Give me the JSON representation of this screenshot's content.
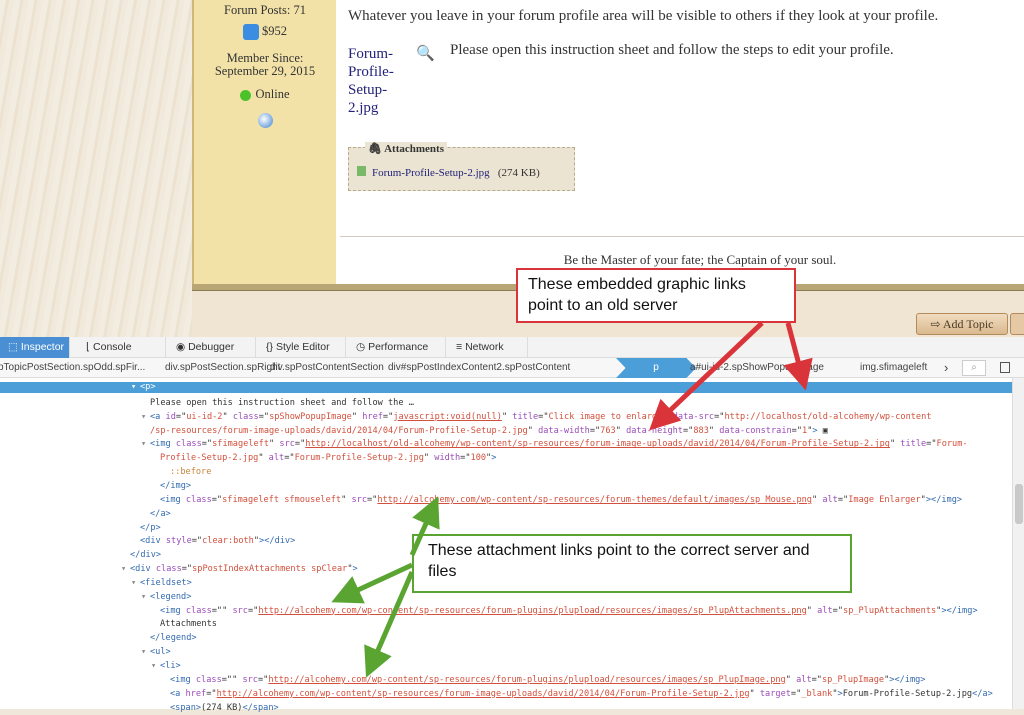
{
  "forum": {
    "profile": {
      "posts": "Forum Posts: 71",
      "money": "$952",
      "member_since_label": "Member Since:",
      "member_since": "September 29, 2015",
      "status": "Online"
    },
    "post": {
      "intro": "Whatever you leave in your forum profile area will be visible to others if they look at your profile.",
      "image_link": "Forum-Profile-Setup-2.jpg",
      "instruction": "Please open this instruction sheet and follow the steps to edit your profile.",
      "attachments_label": "Attachments",
      "attachment_name": "Forum-Profile-Setup-2.jpg",
      "attachment_size": "(274 KB)",
      "signature": "Be the Master of your fate; the Captain of your soul."
    },
    "add_topic": "Add Topic"
  },
  "devtools": {
    "tabs": [
      {
        "label": "Inspector",
        "icon": "inspector-icon"
      },
      {
        "label": "Console",
        "icon": "console-icon"
      },
      {
        "label": "Debugger",
        "icon": "debugger-icon"
      },
      {
        "label": "Style Editor",
        "icon": "style-editor-icon"
      },
      {
        "label": "Performance",
        "icon": "performance-icon"
      },
      {
        "label": "Network",
        "icon": "network-icon"
      }
    ],
    "selected_tab": "Inspector",
    "breadcrumbs": [
      "pTopicPostSection.spOdd.spFir...",
      "div.spPostSection.spRight",
      "div.spPostContentSection",
      "div#spPostIndexContent2.spPostContent",
      "p",
      "a#ui-id-2.spShowPopupImage",
      "img.sfimageleft"
    ],
    "selected_crumb": "p",
    "lines": [
      {
        "depth": 2,
        "twisty": true,
        "sel": true,
        "tokens": [
          [
            "tg",
            "<p>"
          ]
        ]
      },
      {
        "depth": 3,
        "tokens": [
          [
            "tx",
            "Please open this instruction sheet and follow the …"
          ]
        ]
      },
      {
        "depth": 3,
        "twisty": true,
        "tokens": [
          [
            "tg",
            "<a "
          ],
          [
            "at",
            "id"
          ],
          [
            "tx",
            "=\""
          ],
          [
            "va",
            "ui-id-2"
          ],
          [
            "tx",
            "\" "
          ],
          [
            "at",
            "class"
          ],
          [
            "tx",
            "=\""
          ],
          [
            "va",
            "spShowPopupImage"
          ],
          [
            "tx",
            "\" "
          ],
          [
            "at",
            "href"
          ],
          [
            "tx",
            "=\""
          ],
          [
            "lk",
            "javascript:void(null)"
          ],
          [
            "tx",
            "\" "
          ],
          [
            "at",
            "title"
          ],
          [
            "tx",
            "=\""
          ],
          [
            "va",
            "Click image to enlarge"
          ],
          [
            "tx",
            "\" "
          ],
          [
            "at",
            "data-src"
          ],
          [
            "tx",
            "=\""
          ],
          [
            "va",
            "http://localhost/old-alcohemy/wp-content"
          ]
        ]
      },
      {
        "depth": 3,
        "cont": true,
        "tokens": [
          [
            "va",
            "/sp-resources/forum-image-uploads/david/2014/04/Forum-Profile-Setup-2.jpg"
          ],
          [
            "tx",
            "\" "
          ],
          [
            "at",
            "data-width"
          ],
          [
            "tx",
            "=\""
          ],
          [
            "va",
            "763"
          ],
          [
            "tx",
            "\" "
          ],
          [
            "at",
            "data-height"
          ],
          [
            "tx",
            "=\""
          ],
          [
            "va",
            "883"
          ],
          [
            "tx",
            "\" "
          ],
          [
            "at",
            "data-constrain"
          ],
          [
            "tx",
            "=\""
          ],
          [
            "va",
            "1"
          ],
          [
            "tx",
            "\""
          ],
          [
            "tg",
            ">"
          ],
          [
            "tx",
            " ▣"
          ]
        ]
      },
      {
        "depth": 3,
        "twisty": true,
        "tokens": [
          [
            "tg",
            "<img "
          ],
          [
            "at",
            "class"
          ],
          [
            "tx",
            "=\""
          ],
          [
            "va",
            "sfimageleft"
          ],
          [
            "tx",
            "\" "
          ],
          [
            "at",
            "src"
          ],
          [
            "tx",
            "=\""
          ],
          [
            "lk",
            "http://localhost/old-alcohemy/wp-content/sp-resources/forum-image-uploads/david/2014/04/Forum-Profile-Setup-2.jpg"
          ],
          [
            "tx",
            "\" "
          ],
          [
            "at",
            "title"
          ],
          [
            "tx",
            "=\""
          ],
          [
            "va",
            "Forum-"
          ]
        ]
      },
      {
        "depth": 4,
        "cont": true,
        "tokens": [
          [
            "va",
            "Profile-Setup-2.jpg"
          ],
          [
            "tx",
            "\" "
          ],
          [
            "at",
            "alt"
          ],
          [
            "tx",
            "=\""
          ],
          [
            "va",
            "Forum-Profile-Setup-2.jpg"
          ],
          [
            "tx",
            "\" "
          ],
          [
            "at",
            "width"
          ],
          [
            "tx",
            "=\""
          ],
          [
            "va",
            "100"
          ],
          [
            "tx",
            "\""
          ],
          [
            "tg",
            ">"
          ]
        ]
      },
      {
        "depth": 5,
        "tokens": [
          [
            "ps",
            "::before"
          ]
        ]
      },
      {
        "depth": 4,
        "tokens": [
          [
            "tg",
            "</img>"
          ]
        ]
      },
      {
        "depth": 4,
        "tokens": [
          [
            "tg",
            "<img "
          ],
          [
            "at",
            "class"
          ],
          [
            "tx",
            "=\""
          ],
          [
            "va",
            "sfimageleft sfmouseleft"
          ],
          [
            "tx",
            "\" "
          ],
          [
            "at",
            "src"
          ],
          [
            "tx",
            "=\""
          ],
          [
            "lk",
            "http://alcohemy.com/wp-content/sp-resources/forum-themes/default/images/sp_Mouse.png"
          ],
          [
            "tx",
            "\" "
          ],
          [
            "at",
            "alt"
          ],
          [
            "tx",
            "=\""
          ],
          [
            "va",
            "Image Enlarger"
          ],
          [
            "tx",
            "\""
          ],
          [
            "tg",
            "></img>"
          ]
        ]
      },
      {
        "depth": 3,
        "tokens": [
          [
            "tg",
            "</a>"
          ]
        ]
      },
      {
        "depth": 2,
        "tokens": [
          [
            "tg",
            "</p>"
          ]
        ]
      },
      {
        "depth": 2,
        "tokens": [
          [
            "tg",
            "<div "
          ],
          [
            "at",
            "style"
          ],
          [
            "tx",
            "=\""
          ],
          [
            "va",
            "clear:both"
          ],
          [
            "tx",
            "\""
          ],
          [
            "tg",
            "></div>"
          ]
        ]
      },
      {
        "depth": 1,
        "tokens": [
          [
            "tg",
            "</div>"
          ]
        ]
      },
      {
        "depth": 1,
        "twisty": true,
        "tokens": [
          [
            "tg",
            "<div "
          ],
          [
            "at",
            "class"
          ],
          [
            "tx",
            "=\""
          ],
          [
            "va",
            "spPostIndexAttachments spClear"
          ],
          [
            "tx",
            "\""
          ],
          [
            "tg",
            ">"
          ]
        ]
      },
      {
        "depth": 2,
        "twisty": true,
        "tokens": [
          [
            "tg",
            "<fieldset>"
          ]
        ]
      },
      {
        "depth": 3,
        "twisty": true,
        "tokens": [
          [
            "tg",
            "<legend>"
          ]
        ]
      },
      {
        "depth": 4,
        "tokens": [
          [
            "tg",
            "<img "
          ],
          [
            "at",
            "class"
          ],
          [
            "tx",
            "=\"\" "
          ],
          [
            "at",
            "src"
          ],
          [
            "tx",
            "=\""
          ],
          [
            "lk",
            "http://alcohemy.com/wp-content/sp-resources/forum-plugins/plupload/resources/images/sp_PlupAttachments.png"
          ],
          [
            "tx",
            "\" "
          ],
          [
            "at",
            "alt"
          ],
          [
            "tx",
            "=\""
          ],
          [
            "va",
            "sp_PlupAttachments"
          ],
          [
            "tx",
            "\""
          ],
          [
            "tg",
            "></img>"
          ]
        ]
      },
      {
        "depth": 4,
        "tokens": [
          [
            "tx",
            "Attachments"
          ]
        ]
      },
      {
        "depth": 3,
        "tokens": [
          [
            "tg",
            "</legend>"
          ]
        ]
      },
      {
        "depth": 3,
        "twisty": true,
        "tokens": [
          [
            "tg",
            "<ul>"
          ]
        ]
      },
      {
        "depth": 4,
        "twisty": true,
        "tokens": [
          [
            "tg",
            "<li>"
          ]
        ]
      },
      {
        "depth": 5,
        "tokens": [
          [
            "tg",
            "<img "
          ],
          [
            "at",
            "class"
          ],
          [
            "tx",
            "=\"\" "
          ],
          [
            "at",
            "src"
          ],
          [
            "tx",
            "=\""
          ],
          [
            "lk",
            "http://alcohemy.com/wp-content/sp-resources/forum-plugins/plupload/resources/images/sp_PlupImage.png"
          ],
          [
            "tx",
            "\" "
          ],
          [
            "at",
            "alt"
          ],
          [
            "tx",
            "=\""
          ],
          [
            "va",
            "sp_PlupImage"
          ],
          [
            "tx",
            "\""
          ],
          [
            "tg",
            "></img>"
          ]
        ]
      },
      {
        "depth": 5,
        "tokens": [
          [
            "tg",
            "<a "
          ],
          [
            "at",
            "href"
          ],
          [
            "tx",
            "=\""
          ],
          [
            "lk",
            "http://alcohemy.com/wp-content/sp-resources/forum-image-uploads/david/2014/04/Forum-Profile-Setup-2.jpg"
          ],
          [
            "tx",
            "\" "
          ],
          [
            "at",
            "target"
          ],
          [
            "tx",
            "=\""
          ],
          [
            "va",
            "_blank"
          ],
          [
            "tx",
            "\""
          ],
          [
            "tg",
            ">"
          ],
          [
            "tx",
            "Forum-Profile-Setup-2.jpg"
          ],
          [
            "tg",
            "</a>"
          ]
        ]
      },
      {
        "depth": 5,
        "tokens": [
          [
            "tg",
            "<span>"
          ],
          [
            "tx",
            "(274 KB)"
          ],
          [
            "tg",
            "</span>"
          ]
        ]
      }
    ]
  },
  "annotations": {
    "old_server": "These embedded graphic links point to an old server",
    "correct_server": "These attachment links point to the correct server and files",
    "colors": {
      "red": "#d9343a",
      "green": "#5aa532"
    }
  }
}
